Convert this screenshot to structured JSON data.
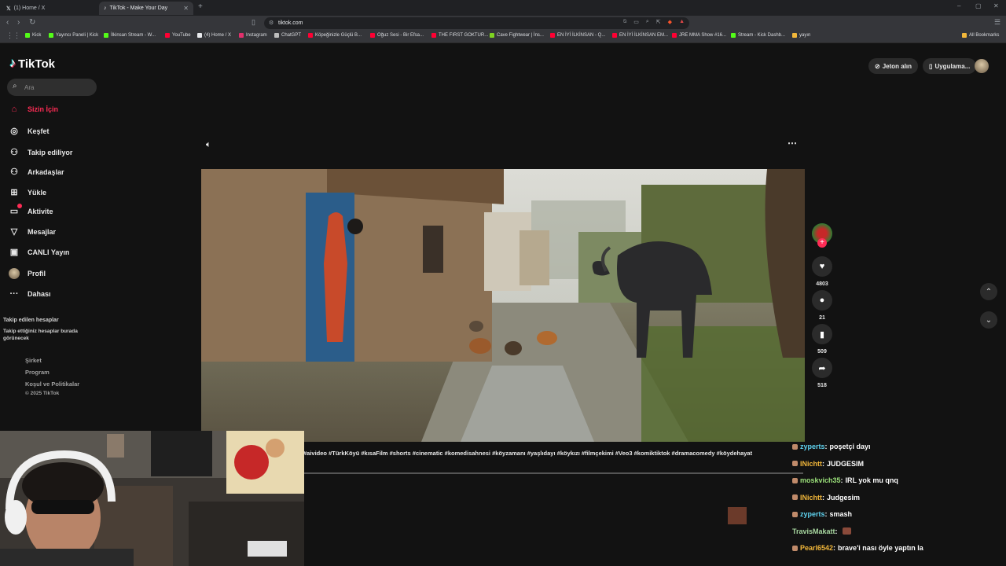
{
  "browser": {
    "tabs": [
      {
        "title": "(1) Home / X"
      },
      {
        "title": "TikTok - Make Your Day"
      }
    ],
    "url": "tiktok.com",
    "bookmarks": [
      {
        "label": "Kick",
        "color": "#53fc18"
      },
      {
        "label": "Yayıncı Paneli | Kick",
        "color": "#53fc18"
      },
      {
        "label": "İlkinsan Stream - W...",
        "color": "#53fc18"
      },
      {
        "label": "YouTube",
        "color": "#ff0033"
      },
      {
        "label": "(4) Home / X",
        "color": "#e8eaed"
      },
      {
        "label": "Instagram",
        "color": "#e1306c"
      },
      {
        "label": "ChatGPT",
        "color": "#bdbdbd"
      },
      {
        "label": "Köpeğinizle Güçlü B...",
        "color": "#ff0033"
      },
      {
        "label": "Oğuz Sesi - Bir Efsa...",
        "color": "#ff0033"
      },
      {
        "label": "THE FIRST GOKTUR...",
        "color": "#ff0033"
      },
      {
        "label": "Cave Fightwear | İns...",
        "color": "#7ed321"
      },
      {
        "label": "EN İYİ İLKİNSAN - Q...",
        "color": "#ff0033"
      },
      {
        "label": "EN İYİ İLKİNSAN EM...",
        "color": "#ff0033"
      },
      {
        "label": "JRE MMA Show #16...",
        "color": "#ff0033"
      },
      {
        "label": "Stream - Kick Dashb...",
        "color": "#53fc18"
      },
      {
        "label": "yayın",
        "color": "#f2b73a"
      }
    ],
    "all_bookmarks": "All Bookmarks"
  },
  "tiktok": {
    "logo": "TikTok",
    "search_placeholder": "Ara",
    "nav": [
      {
        "label": "Sizin İçin",
        "icon": "home-icon"
      },
      {
        "label": "Keşfet",
        "icon": "compass-icon"
      },
      {
        "label": "Takip ediliyor",
        "icon": "following-icon"
      },
      {
        "label": "Arkadaşlar",
        "icon": "friends-icon"
      },
      {
        "label": "Yükle",
        "icon": "upload-icon"
      },
      {
        "label": "Aktivite",
        "icon": "activity-icon"
      },
      {
        "label": "Mesajlar",
        "icon": "messages-icon"
      },
      {
        "label": "CANLI Yayın",
        "icon": "live-icon"
      },
      {
        "label": "Profil",
        "icon": "profile-avatar-icon"
      },
      {
        "label": "Dahası",
        "icon": "more-icon"
      }
    ],
    "following_title": "Takip edilen hesaplar",
    "following_hint": "Takip ettiğiniz hesaplar burada görünecek",
    "footer_links": [
      "Şirket",
      "Program",
      "Koşul ve Politikalar"
    ],
    "copyright": "© 2025 TikTok",
    "get_coins": "Jeton alın",
    "get_app": "Uygulama...",
    "actions": {
      "likes": "4803",
      "comments": "21",
      "saves": "509",
      "shares": "518"
    },
    "caption": "#aivideo #TürkKöyü #kısaFilm #shorts #cinematic #komedisahnesi #köyzamanı #yaşlıdayı #köykızı #filmçekimi #Veo3 #komiktiktok #dramacomedy #köydehayat"
  },
  "chat": [
    {
      "user": "zyperts",
      "text": "poşetçi dayı",
      "color": "#5fd3f0"
    },
    {
      "user": "INichtt",
      "text": "JUDGESIM",
      "color": "#f2b73a"
    },
    {
      "user": "moskvich35",
      "text": "IRL yok mu qnq",
      "color": "#9be07a"
    },
    {
      "user": "INichtt",
      "text": "Judgesim",
      "color": "#f2b73a"
    },
    {
      "user": "zyperts",
      "text": "smash",
      "color": "#5fd3f0"
    },
    {
      "user": "TravisMakatt",
      "text": "",
      "color": "#a8d8a0"
    },
    {
      "user": "Pearl6542",
      "text": "brave'i nası öyle yaptın la",
      "color": "#f2b73a"
    }
  ]
}
